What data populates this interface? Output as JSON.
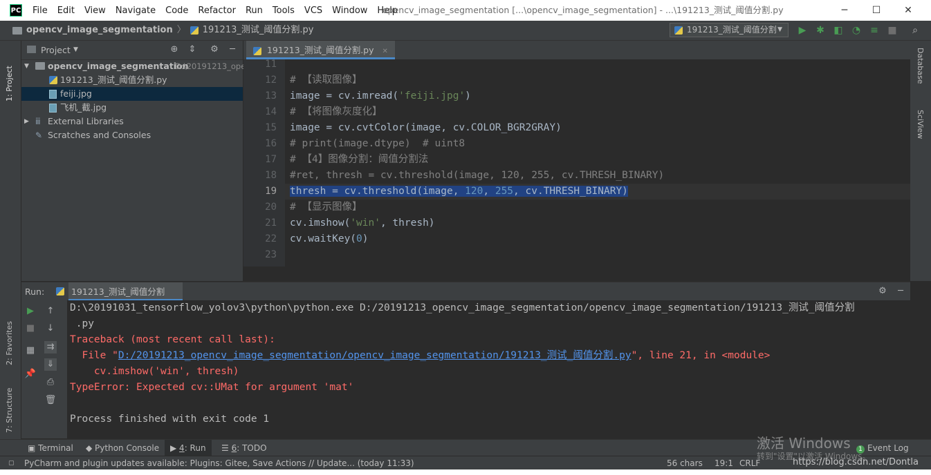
{
  "window": {
    "title": "opencv_image_segmentation [...\\opencv_image_segmentation] - ...\\191213_测试_阈值分割.py",
    "logo": "PC",
    "minimize": "─",
    "maximize": "☐",
    "close": "✕"
  },
  "menu": [
    "File",
    "Edit",
    "View",
    "Navigate",
    "Code",
    "Refactor",
    "Run",
    "Tools",
    "VCS",
    "Window",
    "Help"
  ],
  "breadcrumb": {
    "project": "opencv_image_segmentation",
    "file": "191213_测试_阈值分割.py"
  },
  "run_config": {
    "label": "191213_测试_阈值分割"
  },
  "colors": {
    "run_green": "#499c54",
    "selection": "#214283",
    "error": "#ff6b68",
    "link": "#5394ec"
  },
  "left_stripe": {
    "project_tab": "1: Project",
    "favorites_tab": "2: Favorites",
    "structure_tab": "7: Structure"
  },
  "right_stripe": {
    "database_tab": "Database",
    "sciview_tab": "SciView"
  },
  "project_panel": {
    "title": "Project",
    "tree": [
      {
        "label": "opencv_image_segmentation",
        "suffix": "D:\\20191213_ope",
        "icon": "folder-icon"
      },
      {
        "label": "191213_测试_阈值分割.py",
        "icon": "python-file-icon"
      },
      {
        "label": "feiji.jpg",
        "icon": "image-file-icon"
      },
      {
        "label": "飞机_截.jpg",
        "icon": "image-file-icon"
      },
      {
        "label": "External Libraries",
        "icon": "library-icon"
      },
      {
        "label": "Scratches and Consoles",
        "icon": "scratches-icon"
      }
    ]
  },
  "editor": {
    "tab": "191213_测试_阈值分割.py",
    "current_line": "19",
    "lines": [
      {
        "n": "11",
        "parts": []
      },
      {
        "n": "12",
        "parts": [
          {
            "t": "# 【读取图像】",
            "c": "c-comment"
          }
        ]
      },
      {
        "n": "13",
        "parts": [
          {
            "t": "image = cv.imread(",
            "c": ""
          },
          {
            "t": "'feiji.jpg'",
            "c": "c-str"
          },
          {
            "t": ")",
            "c": ""
          }
        ]
      },
      {
        "n": "14",
        "parts": [
          {
            "t": "# 【将图像灰度化】",
            "c": "c-comment"
          }
        ]
      },
      {
        "n": "15",
        "parts": [
          {
            "t": "image = cv.cvtColor(image, cv.COLOR_BGR2GRAY)",
            "c": ""
          }
        ]
      },
      {
        "n": "16",
        "parts": [
          {
            "t": "# print(image.dtype)  # uint8",
            "c": "c-comment"
          }
        ]
      },
      {
        "n": "17",
        "parts": [
          {
            "t": "# 【4】图像分割：阈值分割法",
            "c": "c-comment"
          }
        ]
      },
      {
        "n": "18",
        "parts": [
          {
            "t": "#ret, thresh = cv.threshold(image, 120, 255, cv.THRESH_BINARY)",
            "c": "c-comment"
          }
        ]
      },
      {
        "n": "19",
        "parts": [
          {
            "t": "thresh = cv.threshold(image, ",
            "c": "c-sel"
          },
          {
            "t": "120",
            "c": "c-sel c-num"
          },
          {
            "t": ", ",
            "c": "c-sel"
          },
          {
            "t": "255",
            "c": "c-sel c-num"
          },
          {
            "t": ", cv.THRESH_BINARY)",
            "c": "c-sel"
          }
        ]
      },
      {
        "n": "20",
        "parts": [
          {
            "t": "# 【显示图像】",
            "c": "c-comment"
          }
        ]
      },
      {
        "n": "21",
        "parts": [
          {
            "t": "cv.imshow(",
            "c": ""
          },
          {
            "t": "'win'",
            "c": "c-str"
          },
          {
            "t": ", thresh)",
            "c": ""
          }
        ]
      },
      {
        "n": "22",
        "parts": [
          {
            "t": "cv.waitKey(",
            "c": ""
          },
          {
            "t": "0",
            "c": "c-num"
          },
          {
            "t": ")",
            "c": ""
          }
        ]
      },
      {
        "n": "23",
        "parts": []
      }
    ]
  },
  "run_panel": {
    "label": "Run:",
    "tab": "191213_测试_阈值分割",
    "console": [
      {
        "t": "D:\\20191031_tensorflow_yolov3\\python\\python.exe D:/20191213_opencv_image_segmentation/opencv_image_segmentation/191213_测试_阈值分割",
        "c": ""
      },
      {
        "t": " .py",
        "c": ""
      },
      {
        "t": "Traceback (most recent call last):",
        "c": "err"
      },
      {
        "t": "  File \"",
        "c": "err",
        "link": "D:/20191213_opencv_image_segmentation/opencv_image_segmentation/191213_测试_阈值分割.py",
        "after": "\", line 21, in <module>"
      },
      {
        "t": "    cv.imshow('win', thresh)",
        "c": "err"
      },
      {
        "t": "TypeError: Expected cv::UMat for argument 'mat'",
        "c": "err"
      },
      {
        "t": "",
        "c": ""
      },
      {
        "t": "Process finished with exit code 1",
        "c": ""
      }
    ]
  },
  "bottom_tabs": {
    "terminal": "Terminal",
    "python_console": "Python Console",
    "run_num": "4",
    "run": ": Run",
    "todo_num": "6",
    "todo": ": TODO",
    "event_log": "Event Log",
    "event_count": "1"
  },
  "statusbar": {
    "message": "PyCharm and plugin updates available: Plugins: Gitee, Save Actions // Update... (today 11:33)",
    "chars": "56 chars",
    "position": "19:1",
    "line_sep": "CRLF"
  },
  "watermark": {
    "activate": "激活 Windows",
    "sub": "转到\"设置\"以激活 Windows。",
    "url": "https://blog.csdn.net/Dontla"
  }
}
